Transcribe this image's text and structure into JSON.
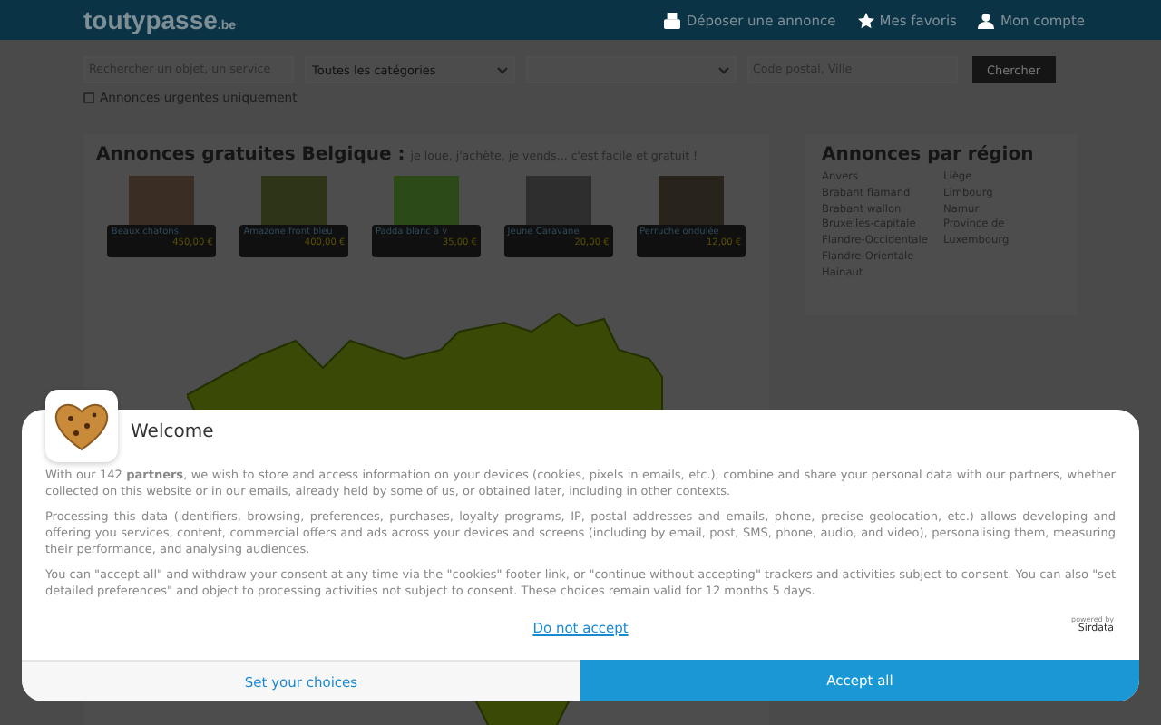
{
  "header": {
    "logo": "toutypasse",
    "logo_suffix": ".be",
    "nav": [
      {
        "kind": "post",
        "label": "Déposer une annonce"
      },
      {
        "kind": "star",
        "label": "Mes favoris"
      },
      {
        "kind": "user",
        "label": "Mon compte"
      }
    ]
  },
  "search": {
    "query_placeholder": "Rechercher un objet, un service",
    "category": "Toutes les catégories",
    "location_placeholder": "Code postal, Ville",
    "button": "Chercher",
    "urgent": {
      "label": "Annonces urgentes uniquement",
      "checked": false
    }
  },
  "main": {
    "title": "Annonces gratuites Belgique :",
    "tagline": "je loue, j'achète, je vends... c'est facile et gratuit !",
    "listings": [
      {
        "title": "Beaux chatons",
        "price": "450,00 €",
        "color": "#3a2e24"
      },
      {
        "title": "Amazone front bleu",
        "price": "400,00 €",
        "color": "#2e3418"
      },
      {
        "title": "Padda blanc à v",
        "price": "35,00 €",
        "color": "#2c4a18"
      },
      {
        "title": "Jeune Caravane",
        "price": "20,00 €",
        "color": "#2e2e2e"
      },
      {
        "title": "Perruche ondulée",
        "price": "12,00 €",
        "color": "#28241c"
      }
    ]
  },
  "regions": {
    "title": "Annonces par région",
    "column_1": [
      "Anvers",
      "Brabant flamand",
      "Brabant wallon",
      "Bruxelles-capitale",
      "Flandre-Occidentale",
      "Flandre-Orientale",
      "Hainaut"
    ],
    "column_2": [
      "Liège",
      "Limbourg",
      "Namur",
      "Province de Luxembourg"
    ]
  },
  "consent": {
    "title": "Welcome",
    "paragraphs": [
      "With our 142 **partners**, we wish to store and access information on your devices (cookies, pixels in emails, etc.), combine and share your personal data with our partners, whether collected on this website or in our emails, already held by some of us, or obtained later, including in other contexts.",
      "Processing this data (identifiers, browsing, preferences, purchases, loyalty programs, IP, postal addresses and emails, phone, precise geolocation, etc.) allows developing and offering you services, content, commercial offers and ads across your devices and screens (including by email, post, SMS, phone, audio, and video), personalising them, measuring their performance, and analysing audiences.",
      "You can \"accept all\" and withdraw your consent at any time via the \"cookies\" footer link, or \"continue without accepting\" trackers and activities subject to consent. You can also \"set detailed preferences\" and object to processing activities not subject to consent. These choices remain valid for 12 months 5 days."
    ],
    "reject": "Do not accept",
    "powered_by": "powered by",
    "brand": "Sirdata",
    "choices": "Set your choices",
    "accept": "Accept all"
  }
}
